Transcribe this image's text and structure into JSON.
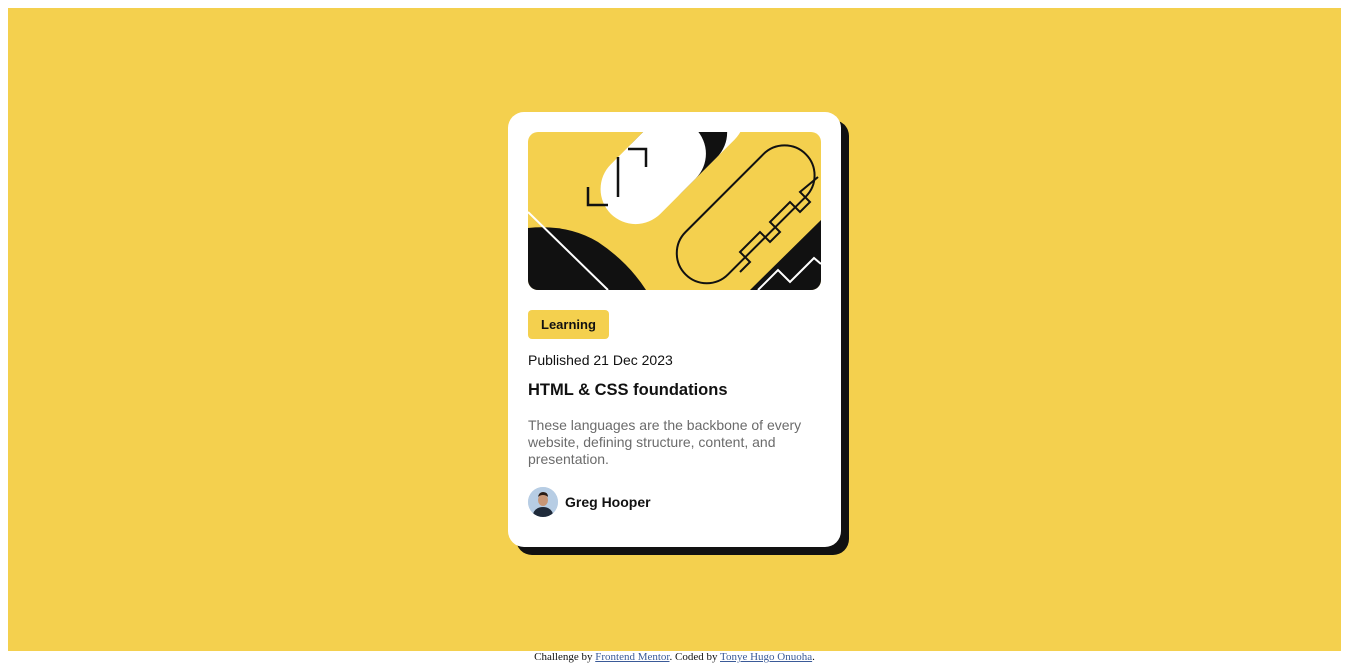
{
  "card": {
    "tag": "Learning",
    "published": "Published 21 Dec 2023",
    "title": "HTML & CSS foundations",
    "description": "These languages are the backbone of every website, defining structure, content, and presentation.",
    "author": "Greg Hooper",
    "hero_icon": "illustration-article",
    "avatar_icon": "avatar-photo"
  },
  "attribution": {
    "prefix": "Challenge by ",
    "link1": "Frontend Mentor",
    "middle": ". Coded by ",
    "link2": "Tonye Hugo Onuoha",
    "suffix": "."
  },
  "colors": {
    "background": "#f4d04e",
    "card": "#ffffff",
    "ink": "#111111",
    "muted": "#6b6b6b"
  }
}
